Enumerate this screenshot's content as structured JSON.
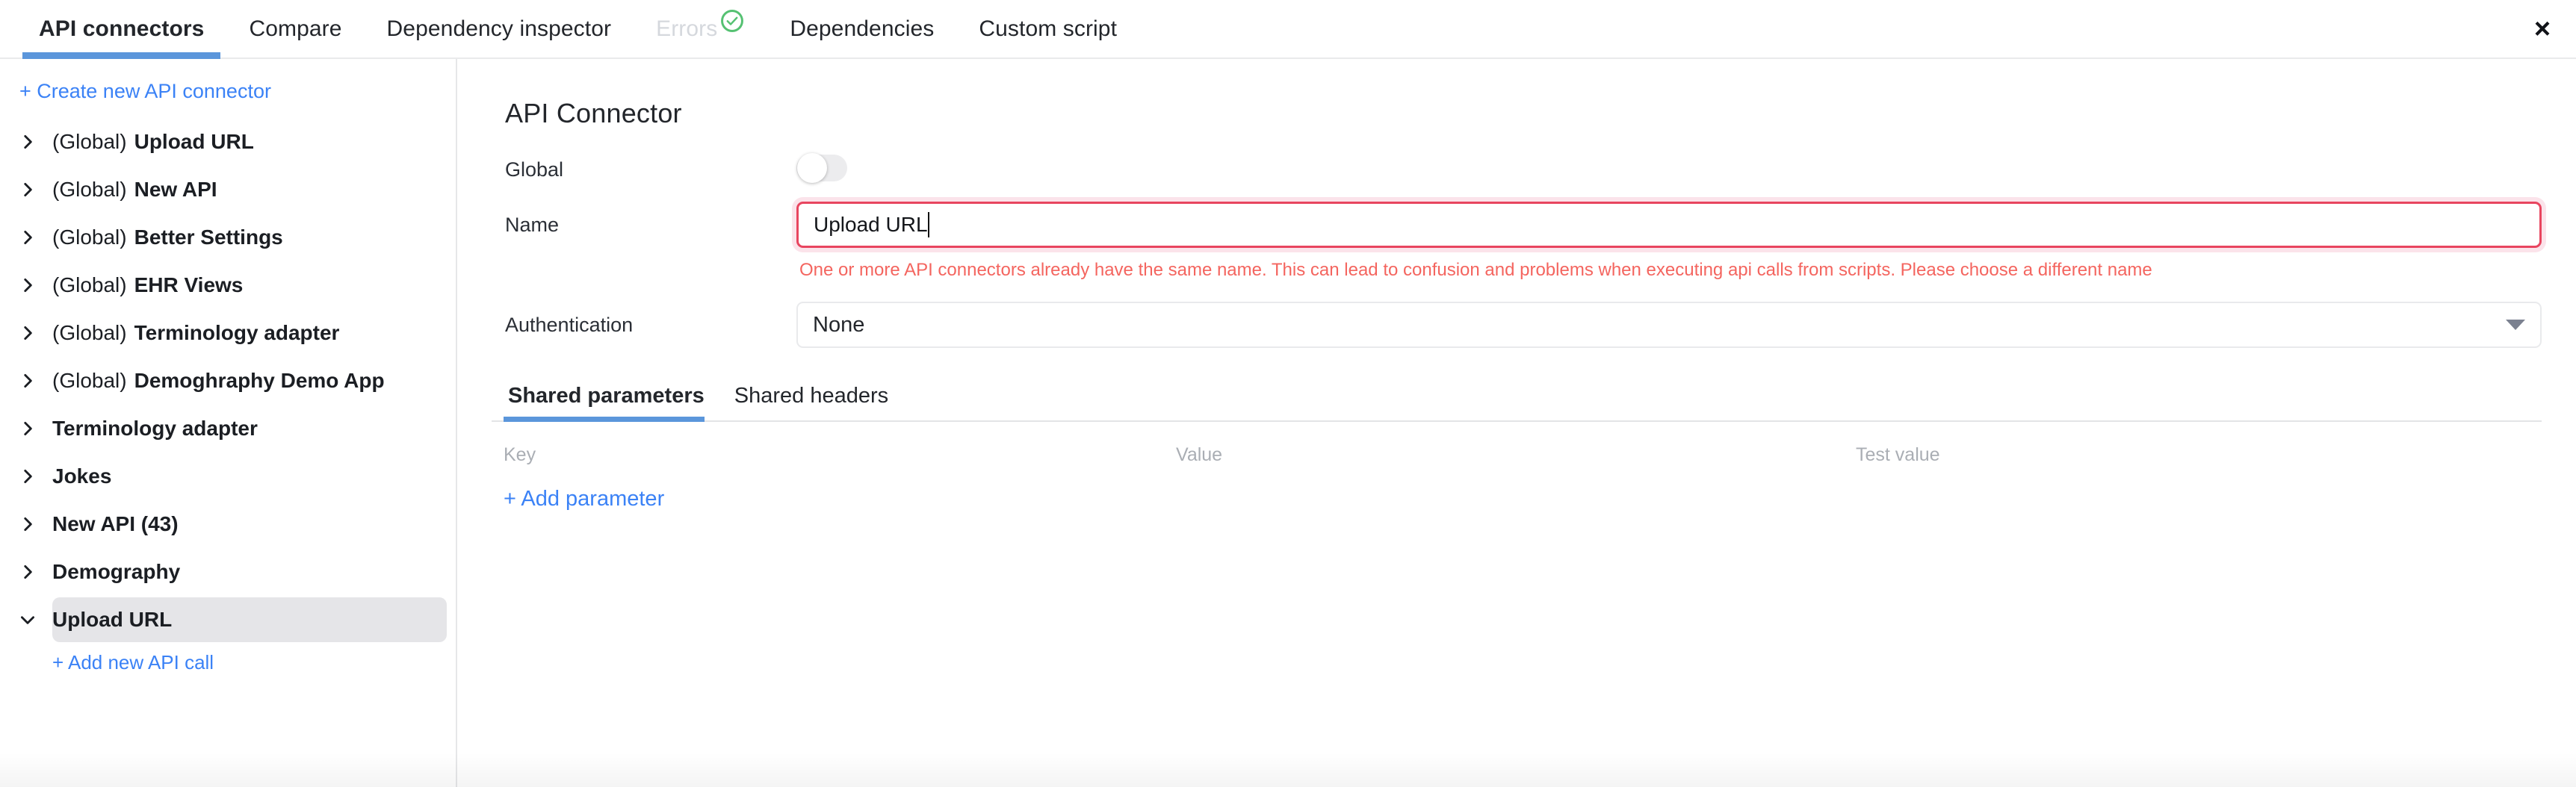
{
  "window": {
    "drag_handle": "drag-handle",
    "close_label": "×"
  },
  "top_tabs": [
    {
      "label": "API connectors",
      "active": true,
      "disabled": false,
      "badge": null
    },
    {
      "label": "Compare",
      "active": false,
      "disabled": false,
      "badge": null
    },
    {
      "label": "Dependency inspector",
      "active": false,
      "disabled": false,
      "badge": null
    },
    {
      "label": "Errors",
      "active": false,
      "disabled": true,
      "badge": "check-circle-icon"
    },
    {
      "label": "Dependencies",
      "active": false,
      "disabled": false,
      "badge": null
    },
    {
      "label": "Custom script",
      "active": false,
      "disabled": false,
      "badge": null
    }
  ],
  "sidebar": {
    "create_link": "+ Create new API connector",
    "add_call_link": "+ Add new API call",
    "items": [
      {
        "prefix": "(Global)",
        "name": "Upload URL",
        "expanded": false,
        "selected": false
      },
      {
        "prefix": "(Global)",
        "name": "New API",
        "expanded": false,
        "selected": false
      },
      {
        "prefix": "(Global)",
        "name": "Better Settings",
        "expanded": false,
        "selected": false
      },
      {
        "prefix": "(Global)",
        "name": "EHR Views",
        "expanded": false,
        "selected": false
      },
      {
        "prefix": "(Global)",
        "name": "Terminology adapter",
        "expanded": false,
        "selected": false
      },
      {
        "prefix": "(Global)",
        "name": "Demoghraphy Demo App",
        "expanded": false,
        "selected": false
      },
      {
        "prefix": "",
        "name": "Terminology adapter",
        "expanded": false,
        "selected": false
      },
      {
        "prefix": "",
        "name": "Jokes",
        "expanded": false,
        "selected": false
      },
      {
        "prefix": "",
        "name": "New API (43)",
        "expanded": false,
        "selected": false
      },
      {
        "prefix": "",
        "name": "Demography",
        "expanded": false,
        "selected": false
      },
      {
        "prefix": "",
        "name": "Upload URL",
        "expanded": true,
        "selected": true
      }
    ]
  },
  "main": {
    "title": "API Connector",
    "global": {
      "label": "Global",
      "enabled": false
    },
    "name": {
      "label": "Name",
      "value": "Upload URL",
      "placeholder": "",
      "error": "One or more API connectors already have the same name. This can lead to confusion and problems when executing api calls from scripts. Please choose a different name"
    },
    "authentication": {
      "label": "Authentication",
      "value": "None"
    },
    "subtabs": [
      {
        "label": "Shared parameters",
        "active": true
      },
      {
        "label": "Shared headers",
        "active": false
      }
    ],
    "param_table": {
      "headers": {
        "key": "Key",
        "value": "Value",
        "test_value": "Test value"
      },
      "rows": [],
      "add_link": "+ Add parameter"
    }
  },
  "colors": {
    "accent_blue": "#3b82f6",
    "tab_underline": "#5b96db",
    "error_red": "#e8455f",
    "error_text": "#f4655f",
    "check_green": "#55c172",
    "selected_row_bg": "#e5e5e8",
    "muted_text": "#aaaeb4"
  }
}
